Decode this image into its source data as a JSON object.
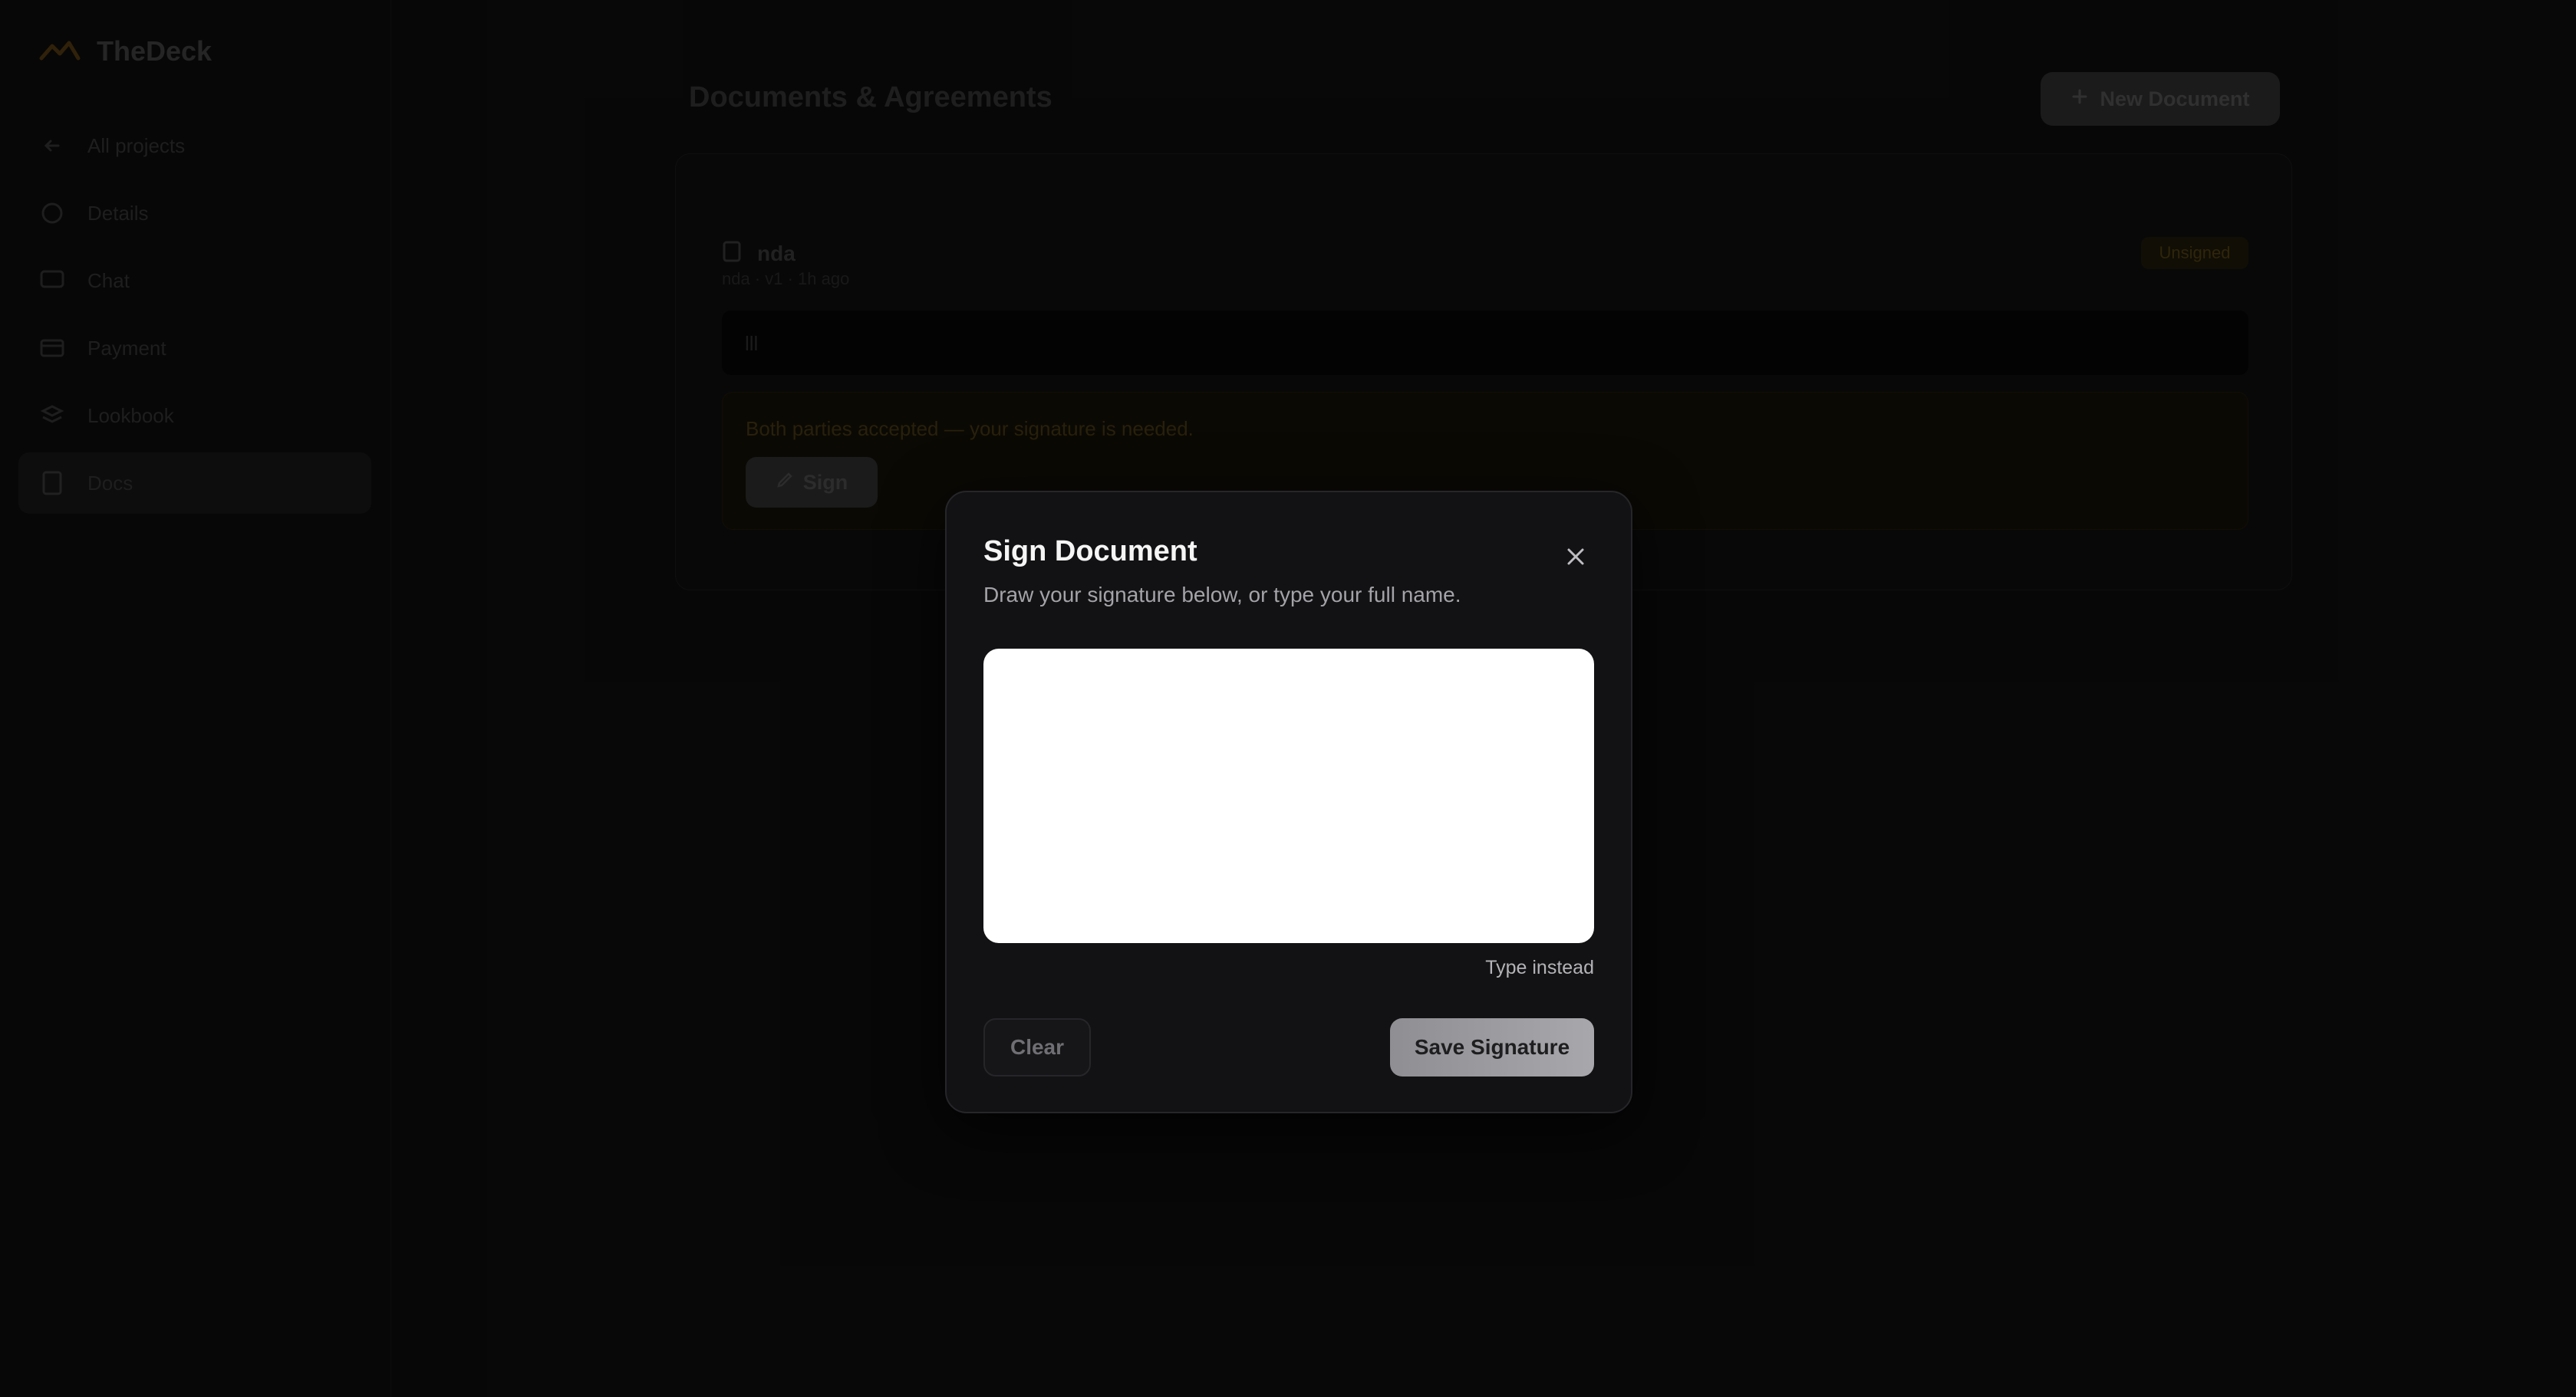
{
  "app": {
    "brand_name": "TheDeck",
    "sidebar": {
      "items": [
        {
          "label": "All projects",
          "icon": "arrow-left-icon",
          "active": false
        },
        {
          "label": "Details",
          "icon": "info-icon",
          "active": false
        },
        {
          "label": "Chat",
          "icon": "chat-icon",
          "active": false
        },
        {
          "label": "Payment",
          "icon": "card-icon",
          "active": false
        },
        {
          "label": "Lookbook",
          "icon": "layers-icon",
          "active": false
        },
        {
          "label": "Docs",
          "icon": "document-icon",
          "active": true
        }
      ]
    },
    "main": {
      "page_title": "Documents & Agreements",
      "new_document_label": "New Document",
      "document": {
        "name": "nda",
        "meta": "nda · v1 · 1h ago",
        "status": "Unsigned",
        "body": "lll",
        "notice": "Both parties accepted — your signature is needed.",
        "sign_label": "Sign"
      }
    }
  },
  "modal": {
    "title": "Sign Document",
    "subtitle": "Draw your signature below, or type your full name.",
    "type_instead": "Type instead",
    "clear_label": "Clear",
    "save_label": "Save Signature"
  },
  "colors": {
    "modal_bg": "#121214",
    "pad_bg": "#ffffff",
    "save_button": "#a0a0a4",
    "accent_brand": "#8a5a12"
  }
}
